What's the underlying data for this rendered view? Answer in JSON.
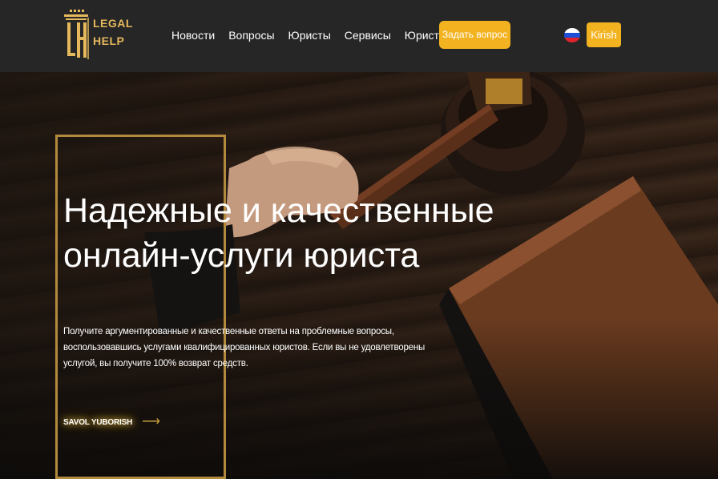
{
  "brand": {
    "logo_line1": "LEGAL",
    "logo_line2": "HELP",
    "logo_icon": "lh-columns-logo-icon",
    "accent_color": "#f3b321",
    "gold_color": "#b38a3d"
  },
  "nav": {
    "items": [
      {
        "label": "Новости"
      },
      {
        "label": "Вопросы"
      },
      {
        "label": "Юристы"
      },
      {
        "label": "Сервисы"
      },
      {
        "label": "Юристам"
      }
    ],
    "ask_button": "Задать вопрос",
    "language_flag": "russia-flag-icon",
    "login_button": "Kirish"
  },
  "hero": {
    "title": "Надежные и качественные онлайн-услуги юриста",
    "description": "Получите аргументированные и качественные ответы на проблемные вопросы, воспользовавшись услугами квалифицированных юристов. Если вы не удовлетворены услугой, вы получите 100% возврат средств.",
    "cta_label": "SAVOL YUBORISH",
    "cta_icon": "arrow-right-icon"
  }
}
